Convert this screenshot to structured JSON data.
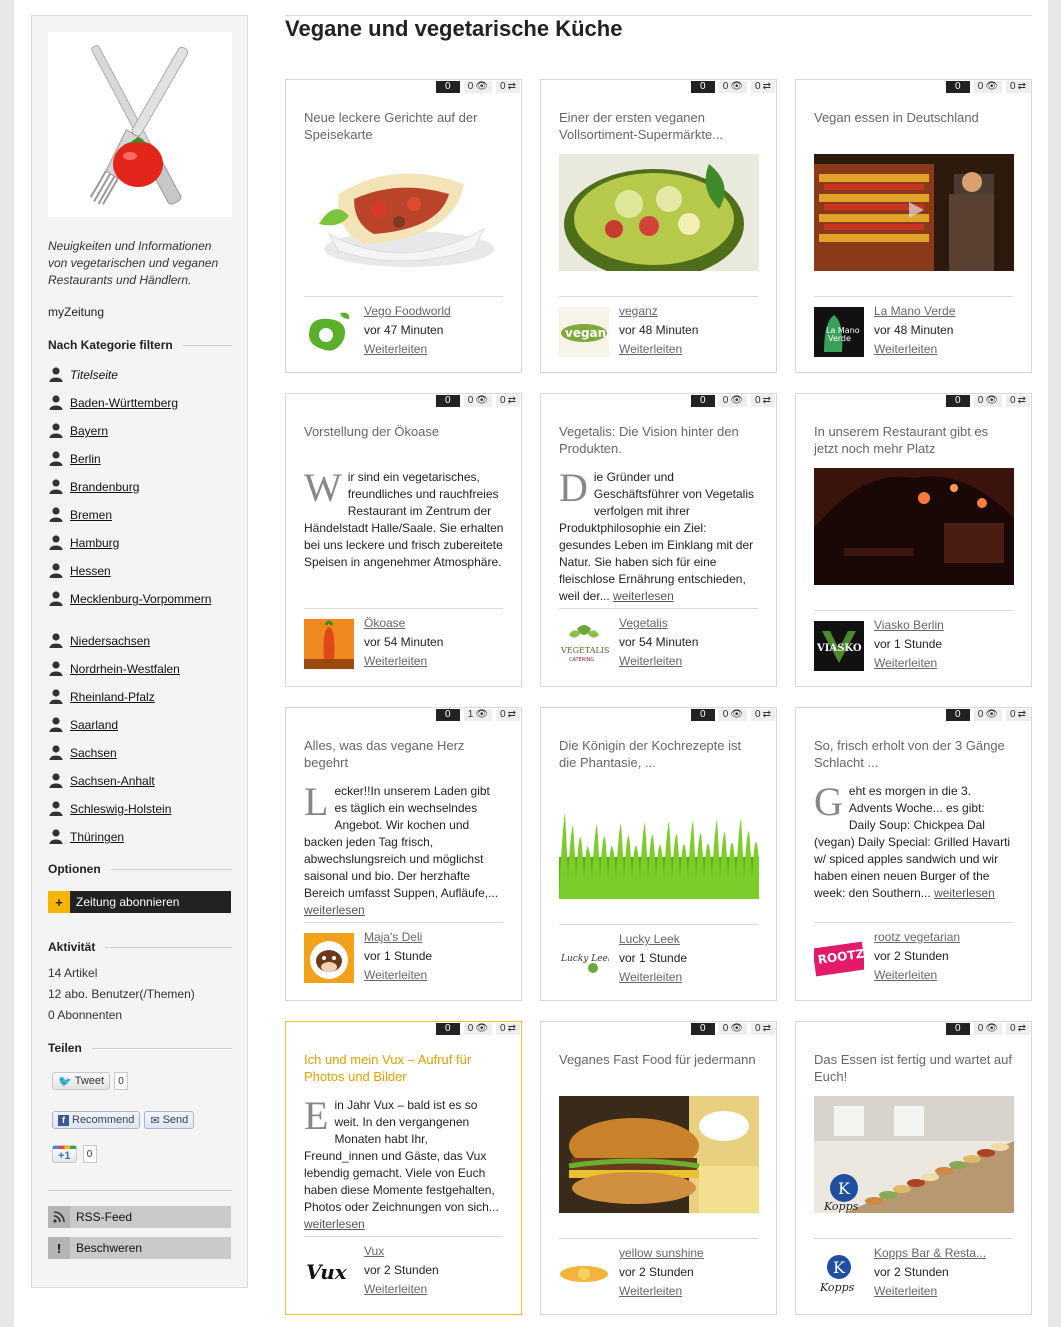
{
  "page_title": "Vegane und vegetarische Küche",
  "sidebar": {
    "tagline": "Neuigkeiten und Informationen von vegetarischen und veganen Restaurants und Händlern.",
    "my_link": "myZeitung",
    "filter_heading": "Nach Kategorie filtern",
    "categories": [
      "Titelseite",
      "Baden-Württemberg",
      "Bayern",
      "Berlin",
      "Brandenburg",
      "Bremen",
      "Hamburg",
      "Hessen",
      "Mecklenburg-Vorpommern",
      "Niedersachsen",
      "Nordrhein-Westfalen",
      "Rheinland-Pfalz",
      "Saarland",
      "Sachsen",
      "Sachsen-Anhalt",
      "Schleswig-Holstein",
      "Thüringen"
    ],
    "options_heading": "Optionen",
    "subscribe_label": "Zeitung abonnieren",
    "activity_heading": "Aktivität",
    "stats": [
      "14 Artikel",
      "12 abo. Benutzer(/Themen)",
      "0 Abonnenten"
    ],
    "share_heading": "Teilen",
    "tweet_label": "Tweet",
    "tweet_count": "0",
    "recommend_label": "Recommend",
    "send_label": "Send",
    "plusone_label": "+1",
    "plusone_count": "0",
    "rss_label": "RSS-Feed",
    "complain_label": "Beschweren"
  },
  "cards": [
    {
      "title": "Neue leckere Gerichte auf der Speisekarte",
      "text": "",
      "source": "Vego Foodworld",
      "time": "vor 47 Minuten",
      "forward": "Weiterleiten",
      "counts": [
        "0",
        "0",
        "0"
      ],
      "image": "wrap"
    },
    {
      "title": "Einer der ersten veganen Vollsortiment-Supermärkte...",
      "text": "",
      "source": "veganz",
      "time": "vor 48 Minuten",
      "forward": "Weiterleiten",
      "counts": [
        "0",
        "0",
        "0"
      ],
      "image": "avocado"
    },
    {
      "title": "Vegan essen in Deutschland",
      "text": "",
      "source": "La Mano Verde",
      "time": "vor 48 Minuten",
      "forward": "Weiterleiten",
      "counts": [
        "0",
        "0",
        "0"
      ],
      "image": "market"
    },
    {
      "title": "Vorstellung der Ökoase",
      "drop": "W",
      "text": "ir sind ein vegetarisches, freundliches und rauchfreies Restaurant im Zentrum der Händelstadt Halle/Saale. Sie erhalten bei uns leckere und frisch zubereitete Speisen in angenehmer Atmosphäre.",
      "more": "",
      "source": "Ökoase",
      "time": "vor 54 Minuten",
      "forward": "Weiterleiten",
      "counts": [
        "0",
        "0",
        "0"
      ]
    },
    {
      "title": "Vegetalis: Die Vision hinter den Produkten.",
      "drop": "D",
      "text": "ie Gründer und Geschäftsführer von Vegetalis verfolgen mit ihrer Produktphilosophie ein Ziel: gesundes Leben im Einklang mit der Natur. Sie haben sich für eine fleischlose Ernährung entschieden, weil der...",
      "more": "weiterlesen",
      "source": "Vegetalis",
      "time": "vor 54 Minuten",
      "forward": "Weiterleiten",
      "counts": [
        "0",
        "0",
        "0"
      ]
    },
    {
      "title": "In unserem Restaurant gibt es jetzt noch mehr Platz",
      "text": "",
      "source": "Viasko Berlin",
      "time": "vor 1 Stunde",
      "forward": "Weiterleiten",
      "counts": [
        "0",
        "0",
        "0"
      ],
      "image": "restaurant"
    },
    {
      "title": "Alles, was das vegane Herz begehrt",
      "drop": "L",
      "text": "ecker!!In unserem Laden gibt es täglich ein wechselndes Angebot. Wir kochen und backen jeden Tag frisch, abwechslungsreich und möglichst saisonal und bio. Der herzhafte Bereich umfasst Suppen, Aufläufe,...",
      "more": "weiterlesen",
      "source": "Maja's Deli",
      "time": "vor 1 Stunde",
      "forward": "Weiterleiten",
      "counts": [
        "0",
        "1",
        "0"
      ]
    },
    {
      "title": "Die Königin der Kochrezepte ist die Phantasie, ...",
      "text": "",
      "source": "Lucky Leek",
      "time": "vor 1 Stunde",
      "forward": "Weiterleiten",
      "counts": [
        "0",
        "0",
        "0"
      ],
      "image": "grass"
    },
    {
      "title": "So, frisch erholt von der 3 Gänge Schlacht ...",
      "drop": "G",
      "text": "eht es morgen in die 3. Advents Woche... es gibt: Daily Soup: Chickpea Dal (vegan) Daily Special: Grilled Havarti w/ spiced apples sandwich und wir haben einen neuen Burger of the week: den Southern...",
      "more": "weiterlesen",
      "source": "rootz vegetarian",
      "time": "vor 2 Stunden",
      "forward": "Weiterleiten",
      "counts": [
        "0",
        "0",
        "0"
      ]
    },
    {
      "title": "Ich und mein Vux – Aufruf für Photos und Bilder",
      "drop": "E",
      "text": "in Jahr Vux – bald ist es so weit. In den vergangenen Monaten habt Ihr, Freund_innen und Gäste, das Vux lebendig gemacht. Viele von Euch haben diese Momente festgehalten, Photos oder Zeichnungen von sich...",
      "more": "weiterlesen",
      "source": "Vux",
      "time": "vor 2 Stunden",
      "forward": "Weiterleiten",
      "counts": [
        "0",
        "0",
        "0"
      ]
    },
    {
      "title": "Veganes Fast Food für jedermann",
      "text": "",
      "source": "yellow sunshine",
      "time": "vor 2 Stunden",
      "forward": "Weiterleiten",
      "counts": [
        "0",
        "0",
        "0"
      ],
      "image": "burger"
    },
    {
      "title": "Das Essen ist fertig und wartet auf Euch!",
      "text": "",
      "source": "Kopps Bar & Resta...",
      "time": "vor 2 Stunden",
      "forward": "Weiterleiten",
      "counts": [
        "0",
        "0",
        "0"
      ],
      "image": "buffet"
    }
  ]
}
